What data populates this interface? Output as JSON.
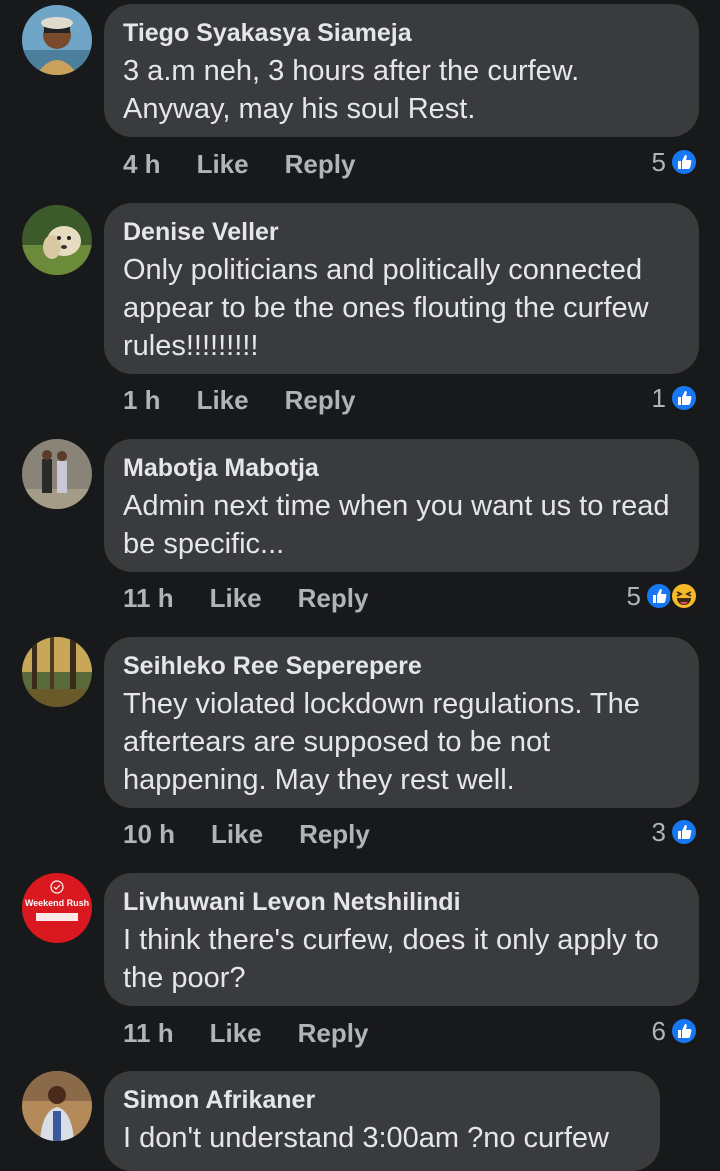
{
  "comments": [
    {
      "author": "Tiego Syakasya Siameja",
      "text": "3 a.m neh, 3 hours after the curfew. Anyway, may his soul Rest.",
      "time": "4 h",
      "like": "Like",
      "reply": "Reply",
      "reactions": "5",
      "icons": [
        "like-icon"
      ]
    },
    {
      "author": "Denise Veller",
      "text": "Only politicians and politically connected appear to be the ones flouting the curfew rules!!!!!!!!!",
      "time": "1 h",
      "like": "Like",
      "reply": "Reply",
      "reactions": "1",
      "icons": [
        "like-icon"
      ]
    },
    {
      "author": "Mabotja Mabotja",
      "text": "Admin next time when you want us to read be specific...",
      "time": "11 h",
      "like": "Like",
      "reply": "Reply",
      "reactions": "5",
      "icons": [
        "like-icon",
        "haha-icon"
      ]
    },
    {
      "author": "Seihleko Ree Seperepere",
      "text": "They violated lockdown regulations. The aftertears are supposed to be not happening. May they rest well.",
      "time": "10 h",
      "like": "Like",
      "reply": "Reply",
      "reactions": "3",
      "icons": [
        "like-icon"
      ]
    },
    {
      "author": "Livhuwani Levon Netshilindi",
      "text": "I think there's curfew, does it only apply to the poor?",
      "time": "11 h",
      "like": "Like",
      "reply": "Reply",
      "reactions": "6",
      "icons": [
        "like-icon"
      ]
    },
    {
      "author": "Simon Afrikaner",
      "text": "I don't understand 3:00am ?no curfew",
      "time": "",
      "like": "",
      "reply": "",
      "reactions": "",
      "icons": []
    }
  ],
  "avatar_badge_text": "Weekend Rush",
  "colors": {
    "background": "#18191a",
    "bubble": "#3a3b3c",
    "meta": "#b0b3b8",
    "like_blue": "#1877f2",
    "haha_yellow": "#f7b928"
  }
}
